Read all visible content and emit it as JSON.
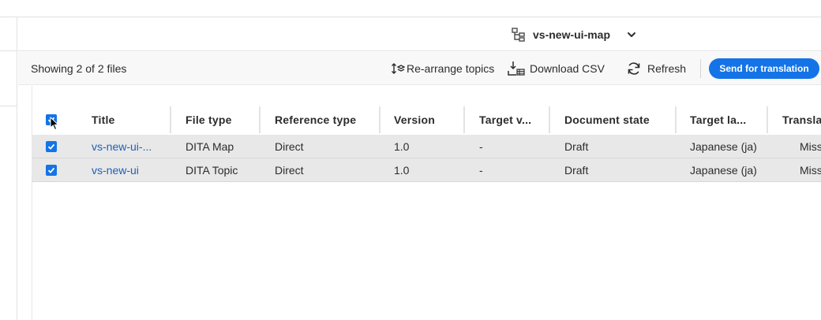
{
  "map": {
    "name": "vs-new-ui-map"
  },
  "toolbar": {
    "count_text": "Showing 2 of 2 files",
    "rearrange_label": "Re-arrange topics",
    "download_label": "Download CSV",
    "refresh_label": "Refresh",
    "send_label": "Send for translation"
  },
  "table": {
    "columns": [
      "Title",
      "File type",
      "Reference type",
      "Version",
      "Target v...",
      "Document state",
      "Target la...",
      "Transla"
    ],
    "rows": [
      [
        "vs-new-ui-...",
        "DITA Map",
        "Direct",
        "1.0",
        "-",
        "Draft",
        "Japanese (ja)",
        "Miss"
      ],
      [
        "vs-new-ui",
        "DITA Topic",
        "Direct",
        "1.0",
        "-",
        "Draft",
        "Japanese (ja)",
        "Miss"
      ]
    ]
  },
  "colors": {
    "accent": "#1473e6",
    "link": "#1f5fb8",
    "row_bg": "#e8e8e8"
  },
  "icons": [
    "map-tree-icon",
    "chevron-down-icon",
    "rearrange-icon",
    "download-icon",
    "refresh-icon",
    "checkbox-checked-icon",
    "mouse-cursor-icon"
  ]
}
